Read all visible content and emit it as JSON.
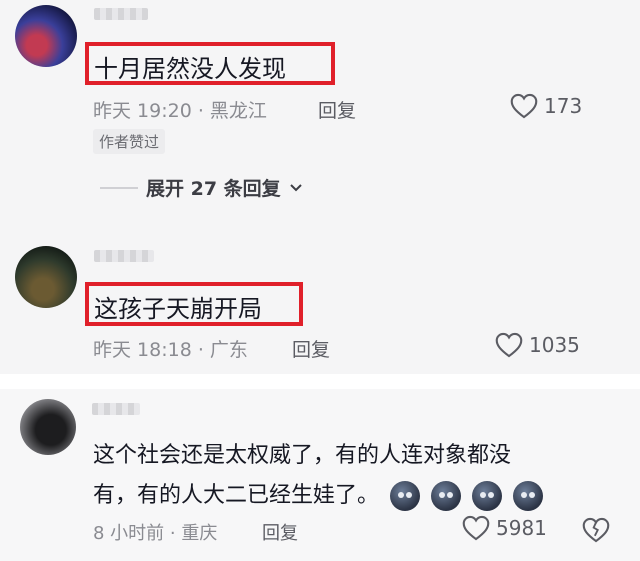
{
  "comments": [
    {
      "text": "十月居然没人发现",
      "meta": "昨天 19:20 · 黑龙江",
      "reply_label": "回复",
      "likes": "173",
      "badge": "作者赞过",
      "expand_label": "展开 27 条回复"
    },
    {
      "text": "这孩子天崩开局",
      "meta": "昨天 18:18 · 广东",
      "reply_label": "回复",
      "likes": "1035"
    },
    {
      "text_line1": "这个社会还是太权威了，有的人连对象都没",
      "text_line2": "有，有的人大二已经生娃了。",
      "meta": "8 小时前 · 重庆",
      "reply_label": "回复",
      "likes": "5981",
      "emoji": "smile-emoji"
    }
  ],
  "colors": {
    "highlight": "#e0202a",
    "panel": "#f5f5f6"
  }
}
